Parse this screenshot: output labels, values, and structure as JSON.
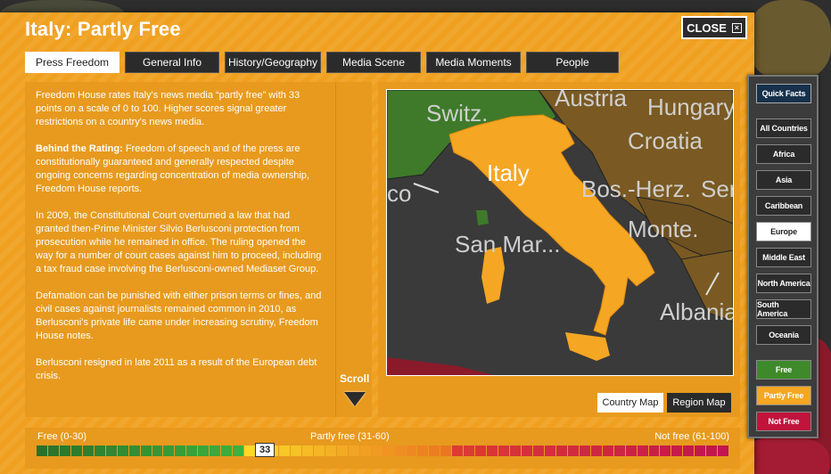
{
  "header": {
    "title": "Italy: Partly Free",
    "close_label": "CLOSE"
  },
  "tabs": [
    {
      "label": "Press Freedom",
      "active": true
    },
    {
      "label": "General Info",
      "active": false
    },
    {
      "label": "History/Geography",
      "active": false
    },
    {
      "label": "Media Scene",
      "active": false
    },
    {
      "label": "Media Moments",
      "active": false
    },
    {
      "label": "People",
      "active": false
    }
  ],
  "content": {
    "p1": "Freedom House rates Italy's news media “partly free” with 33 points on a scale of 0 to 100. Higher scores signal greater restrictions on a country's news media.",
    "p2_heading": "Behind the Rating:",
    "p2_body": " Freedom of speech and of the press are constitutionally guaranteed and generally respected despite ongoing concerns regarding concentration of media ownership, Freedom House reports.",
    "p3": "In 2009, the Constitutional Court overturned a law that had granted then-Prime Minister Silvio Berlusconi protection from prosecution while he remained in office. The ruling opened the way for a number of court cases against him to proceed, including a tax fraud case involving the Berlusconi-owned Mediaset Group.",
    "p4": "Defamation can be punished with either prison terms or fines, and civil cases against journalists remained common in 2010, as Berlusconi's private life came under increasing scrutiny, Freedom House notes.",
    "p5": "Berlusconi resigned in late 2011 as a result of the European debt crisis."
  },
  "scroll_label": "Scroll",
  "map": {
    "labels": {
      "italy": "Italy",
      "switz": "Switz.",
      "austria": "Austria",
      "hungary": "Hungary",
      "croatia": "Croatia",
      "bos_herz": "Bos.-Herz.",
      "ser": "Ser",
      "san_marino": "San Mar...",
      "monte": "Monte.",
      "albania": "Albania",
      "monaco": "co"
    },
    "country_map_label": "Country Map",
    "region_map_label": "Region Map",
    "colors": {
      "italy": "#f5a623",
      "sea": "#3a3a3a",
      "free": "#3e7a2a",
      "partly_free": "#8a6a20",
      "not_free": "#8a1a2a"
    }
  },
  "scale": {
    "free_label": "Free (0-30)",
    "partly_label": "Partly free (31-60)",
    "notfree_label": "Not free (61-100)",
    "score": 33,
    "min": 0,
    "max": 100,
    "free_color": "#3e8a2a",
    "partly_color": "#f5b020",
    "notfree_color": "#c0143c"
  },
  "sidebar": {
    "quick_facts": "Quick Facts",
    "regions": [
      {
        "label": "All Countries",
        "selected": false
      },
      {
        "label": "Africa",
        "selected": false
      },
      {
        "label": "Asia",
        "selected": false
      },
      {
        "label": "Caribbean",
        "selected": false
      },
      {
        "label": "Europe",
        "selected": true
      },
      {
        "label": "Middle East",
        "selected": false
      },
      {
        "label": "North America",
        "selected": false
      },
      {
        "label": "South America",
        "selected": false
      },
      {
        "label": "Oceania",
        "selected": false
      }
    ],
    "filters": [
      {
        "label": "Free",
        "color": "#3e8a2a"
      },
      {
        "label": "Partly Free",
        "color": "#f5a623"
      },
      {
        "label": "Not Free",
        "color": "#c0143c"
      }
    ]
  }
}
